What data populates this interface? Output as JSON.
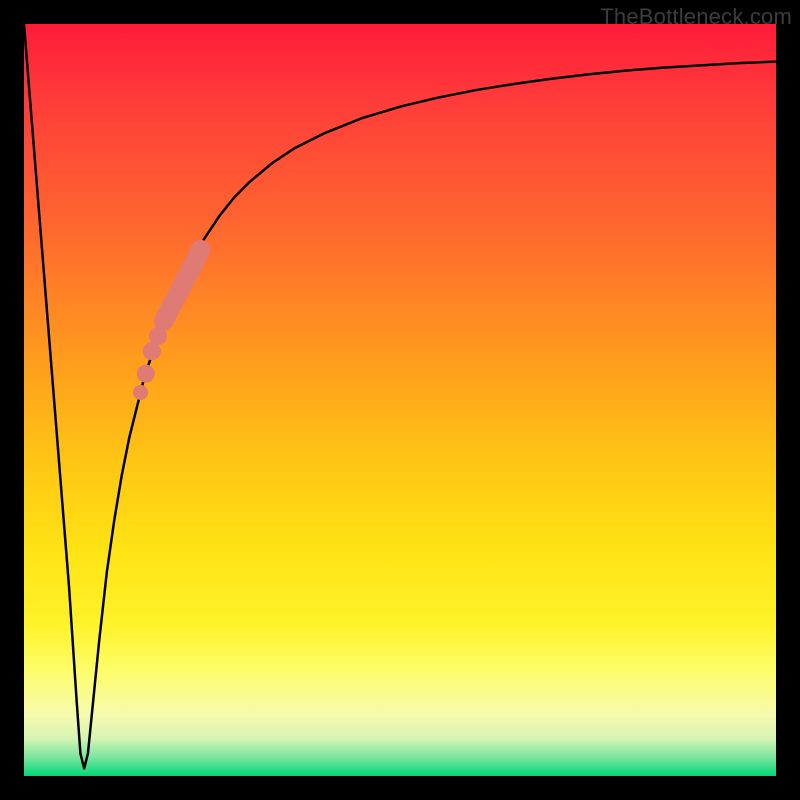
{
  "watermark": "TheBottleneck.com",
  "colors": {
    "frame": "#000000",
    "curve": "#000000",
    "marker": "#e07a74",
    "gradient_top": "#ff1b3a",
    "gradient_bottom": "#00d977"
  },
  "chart_data": {
    "type": "line",
    "title": "",
    "xlabel": "",
    "ylabel": "",
    "xlim": [
      0,
      100
    ],
    "ylim": [
      0,
      100
    ],
    "grid": false,
    "legend": false,
    "annotations": [
      "TheBottleneck.com"
    ],
    "series": [
      {
        "name": "bottleneck-curve",
        "x": [
          0,
          2,
          4,
          6,
          7,
          7.5,
          8,
          8.5,
          9,
          10,
          11,
          12,
          13,
          14,
          15,
          16,
          18,
          20,
          22,
          24,
          26,
          28,
          30,
          33,
          36,
          40,
          45,
          50,
          55,
          60,
          65,
          70,
          75,
          80,
          85,
          90,
          95,
          100
        ],
        "values": [
          100,
          75,
          50,
          25,
          10,
          3,
          1,
          3,
          8,
          18,
          27,
          34,
          40,
          45,
          49,
          53,
          59,
          64,
          68,
          71.5,
          74.5,
          77,
          79,
          81.5,
          83.5,
          85.5,
          87.5,
          89,
          90.2,
          91.2,
          92,
          92.7,
          93.3,
          93.8,
          94.2,
          94.5,
          94.8,
          95
        ]
      }
    ],
    "markers": [
      {
        "name": "dot-1",
        "x": 15.5,
        "y": 51,
        "r": 1.0
      },
      {
        "name": "dot-2",
        "x": 16.2,
        "y": 53.5,
        "r": 1.2
      },
      {
        "name": "dot-3",
        "x": 17.0,
        "y": 56.5,
        "r": 1.2
      },
      {
        "name": "dot-4",
        "x": 17.8,
        "y": 58.5,
        "r": 1.2
      },
      {
        "name": "segment",
        "x0": 18.6,
        "y0": 60.5,
        "x1": 23.5,
        "y1": 70,
        "w": 2.6
      }
    ]
  }
}
